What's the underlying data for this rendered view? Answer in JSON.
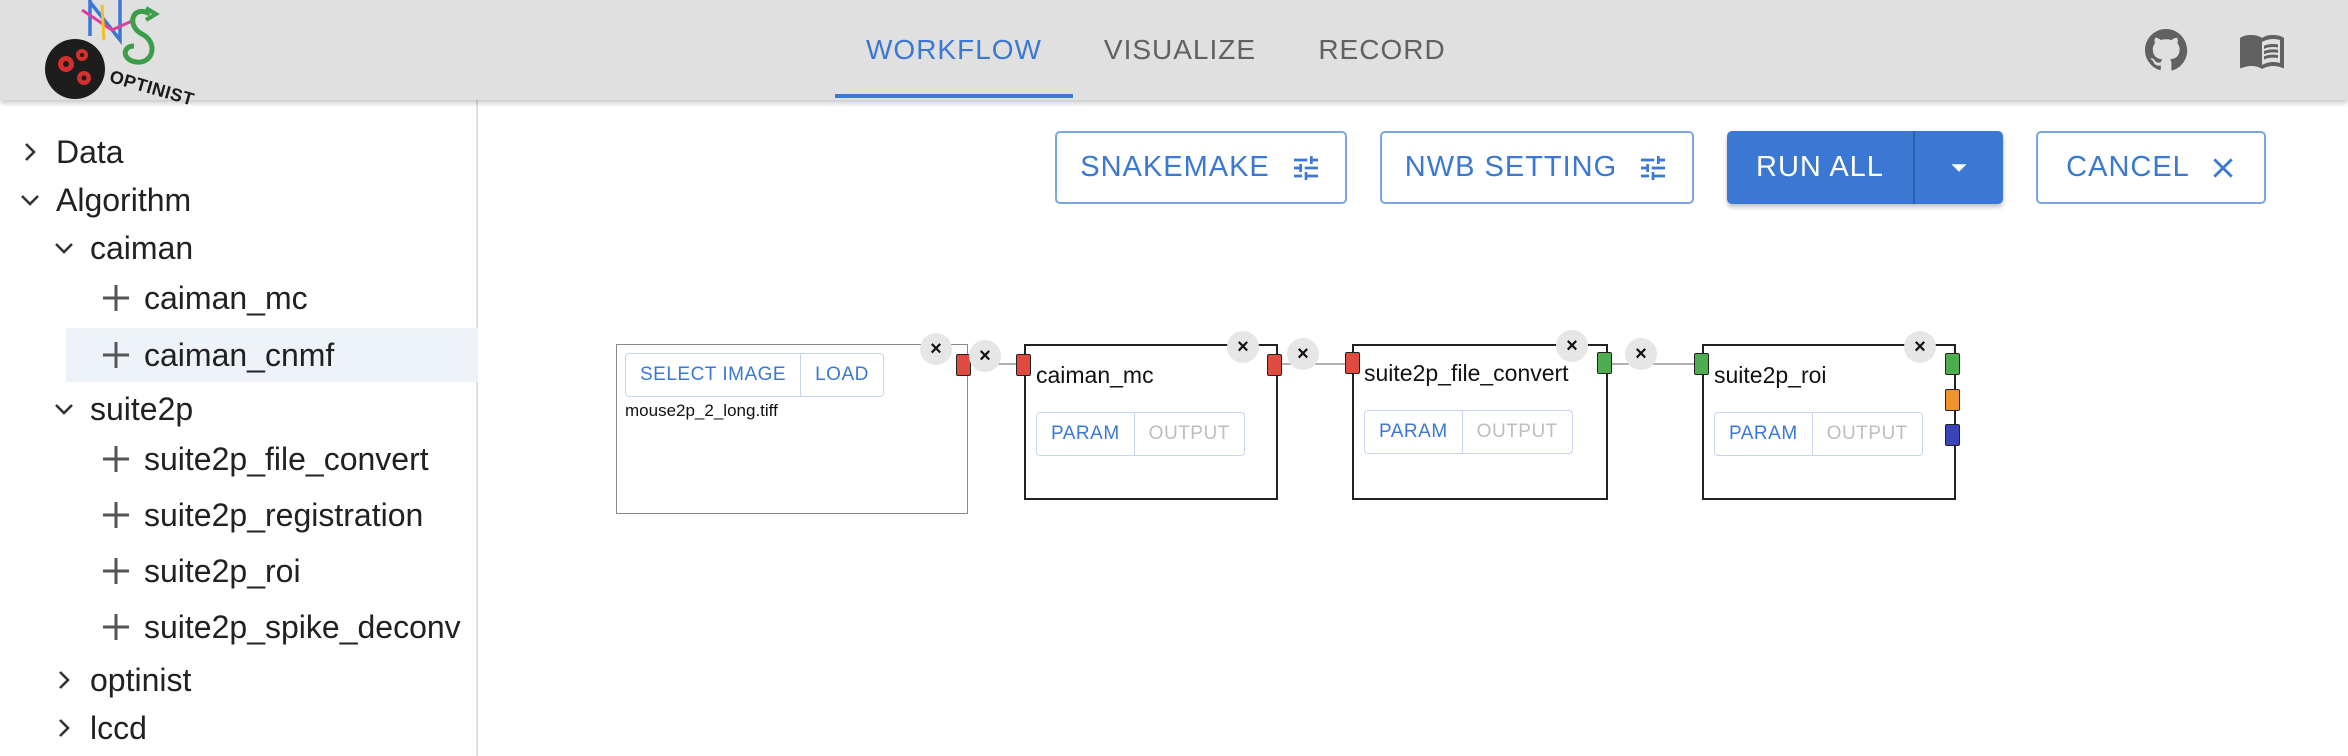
{
  "app": {
    "logo_text": "OPTINIST",
    "tabs": [
      {
        "label": "WORKFLOW",
        "active": true
      },
      {
        "label": "VISUALIZE",
        "active": false
      },
      {
        "label": "RECORD",
        "active": false
      }
    ],
    "icons": [
      "github-icon",
      "book-icon"
    ]
  },
  "sidebar": {
    "tree": [
      {
        "label": "Data",
        "type": "folder",
        "expanded": false
      },
      {
        "label": "Algorithm",
        "type": "folder",
        "expanded": true
      },
      {
        "label": "caiman",
        "type": "folder",
        "expanded": true
      },
      {
        "label": "caiman_mc",
        "type": "item"
      },
      {
        "label": "caiman_cnmf",
        "type": "item",
        "selected": true
      },
      {
        "label": "suite2p",
        "type": "folder",
        "expanded": true
      },
      {
        "label": "suite2p_file_convert",
        "type": "item"
      },
      {
        "label": "suite2p_registration",
        "type": "item"
      },
      {
        "label": "suite2p_roi",
        "type": "item"
      },
      {
        "label": "suite2p_spike_deconv",
        "type": "item"
      },
      {
        "label": "optinist",
        "type": "folder",
        "expanded": false
      },
      {
        "label": "lccd",
        "type": "folder",
        "expanded": false
      }
    ]
  },
  "toolbar": {
    "snakemake_label": "SNAKEMAKE",
    "nwb_label": "NWB SETTING",
    "run_all_label": "RUN ALL",
    "cancel_label": "CANCEL"
  },
  "canvas": {
    "input_node": {
      "select_label": "SELECT IMAGE",
      "load_label": "LOAD",
      "filename": "mouse2p_2_long.tiff"
    },
    "nodes": [
      {
        "title": "caiman_mc",
        "param_label": "PARAM",
        "output_label": "OUTPUT"
      },
      {
        "title": "suite2p_file_convert",
        "param_label": "PARAM",
        "output_label": "OUTPUT"
      },
      {
        "title": "suite2p_roi",
        "param_label": "PARAM",
        "output_label": "OUTPUT"
      }
    ],
    "close_symbol": "×",
    "colors": {
      "accent": "#3a78d4",
      "handle_red": "#e04a3f",
      "handle_green": "#4cae4f",
      "handle_orange": "#f0932b",
      "handle_blue": "#3a44b8"
    }
  }
}
